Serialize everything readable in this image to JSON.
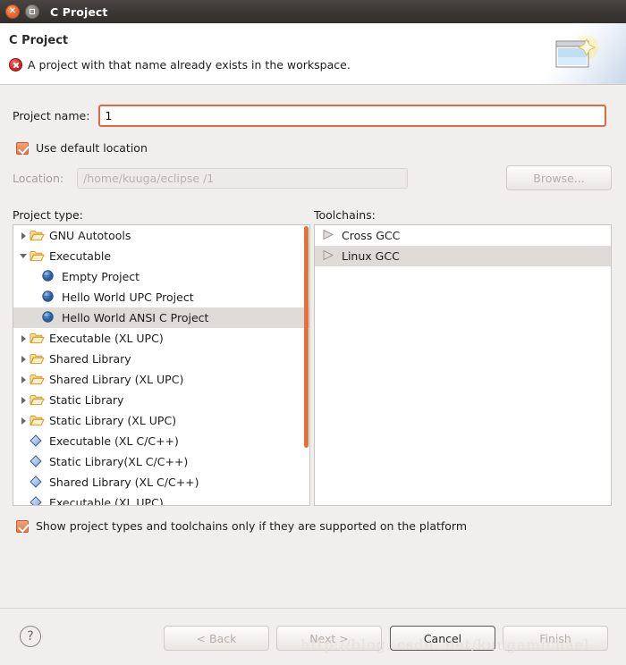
{
  "window": {
    "title": "C Project",
    "close_icon": "close-icon",
    "maximize_icon": "maximize-icon"
  },
  "header": {
    "title": "C Project",
    "error_icon": "error-icon",
    "message": "A project with that name already exists in the workspace.",
    "art_icon": "wizard-window-icon"
  },
  "form": {
    "project_name_label": "Project name:",
    "project_name_value": "1",
    "project_name_placeholder": "",
    "use_default_location_label": "Use default location",
    "use_default_location_checked": true,
    "location_label": "Location:",
    "location_value": "/home/kuuga/eclipse /1",
    "browse_label": "Browse..."
  },
  "project_type": {
    "label": "Project type:",
    "items": [
      {
        "label": "GNU Autotools",
        "icon": "folder-icon",
        "twisty": "collapsed",
        "depth": 0,
        "selected": false
      },
      {
        "label": "Executable",
        "icon": "folder-icon",
        "twisty": "expanded",
        "depth": 0,
        "selected": false
      },
      {
        "label": "Empty Project",
        "icon": "sphere-icon",
        "twisty": "none",
        "depth": 1,
        "selected": false
      },
      {
        "label": "Hello World UPC Project",
        "icon": "sphere-icon",
        "twisty": "none",
        "depth": 1,
        "selected": false
      },
      {
        "label": "Hello World ANSI C Project",
        "icon": "sphere-icon",
        "twisty": "none",
        "depth": 1,
        "selected": true
      },
      {
        "label": "Executable (XL UPC)",
        "icon": "folder-icon",
        "twisty": "collapsed",
        "depth": 0,
        "selected": false
      },
      {
        "label": "Shared Library",
        "icon": "folder-icon",
        "twisty": "collapsed",
        "depth": 0,
        "selected": false
      },
      {
        "label": "Shared Library (XL UPC)",
        "icon": "folder-icon",
        "twisty": "collapsed",
        "depth": 0,
        "selected": false
      },
      {
        "label": "Static Library",
        "icon": "folder-icon",
        "twisty": "collapsed",
        "depth": 0,
        "selected": false
      },
      {
        "label": "Static Library (XL UPC)",
        "icon": "folder-icon",
        "twisty": "collapsed",
        "depth": 0,
        "selected": false
      },
      {
        "label": "Executable (XL C/C++)",
        "icon": "diamond-icon",
        "twisty": "none",
        "depth": 0,
        "selected": false
      },
      {
        "label": "Static Library(XL C/C++)",
        "icon": "diamond-icon",
        "twisty": "none",
        "depth": 0,
        "selected": false
      },
      {
        "label": "Shared Library (XL C/C++)",
        "icon": "diamond-icon",
        "twisty": "none",
        "depth": 0,
        "selected": false
      },
      {
        "label": "Executable (XL UPC)",
        "icon": "diamond-icon",
        "twisty": "none",
        "depth": 0,
        "selected": false
      }
    ]
  },
  "toolchains": {
    "label": "Toolchains:",
    "items": [
      {
        "label": "Cross GCC",
        "icon": "play-icon",
        "selected": false
      },
      {
        "label": "Linux GCC",
        "icon": "play-icon",
        "selected": true
      }
    ]
  },
  "options": {
    "show_supported_label": "Show project types and toolchains only if they are supported on the platform",
    "show_supported_checked": true
  },
  "footer": {
    "help_label": "?",
    "back_label": "< Back",
    "next_label": "Next >",
    "cancel_label": "Cancel",
    "finish_label": "Finish",
    "back_enabled": false,
    "next_enabled": false,
    "finish_enabled": false
  },
  "watermark": "http://blog. csdn. net/kuugamichael",
  "colors": {
    "accent_orange": "#e8703a",
    "titlebar": "#3b3735",
    "dialog_bg": "#f0efee",
    "selection": "#dedbd8",
    "error_red": "#d92b2b"
  }
}
